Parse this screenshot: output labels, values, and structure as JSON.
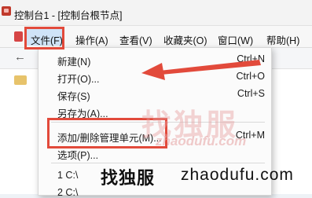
{
  "window": {
    "title": "控制台1 - [控制台根节点]"
  },
  "menubar": {
    "items": [
      "文件(F)",
      "操作(A)",
      "查看(V)",
      "收藏夹(O)",
      "窗口(W)",
      "帮助(H)"
    ]
  },
  "file_menu": {
    "items": [
      {
        "label": "新建(N)",
        "shortcut": "Ctrl+N"
      },
      {
        "label": "打开(O)...",
        "shortcut": "Ctrl+O"
      },
      {
        "label": "保存(S)",
        "shortcut": "Ctrl+S"
      },
      {
        "label": "另存为(A)...",
        "shortcut": ""
      },
      {
        "label": "添加/删除管理单元(M)...",
        "shortcut": "Ctrl+M"
      },
      {
        "label": "选项(P)...",
        "shortcut": ""
      },
      {
        "label": "1 C:\\",
        "shortcut": ""
      },
      {
        "label": "2 C:\\",
        "shortcut": ""
      }
    ]
  },
  "watermark": {
    "cn": "找独服",
    "en": "zhaodufu.com"
  },
  "brand": {
    "cn": "找独服",
    "en": "zhaodufu.com"
  },
  "colors": {
    "highlight_red": "#e24a3b",
    "menu_active": "#cfe3f7"
  }
}
